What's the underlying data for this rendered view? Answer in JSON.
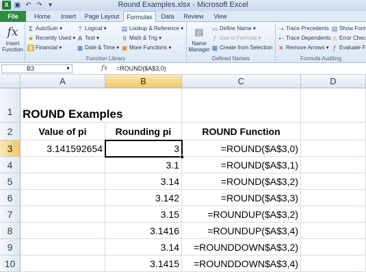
{
  "window": {
    "title": "Round Examples.xlsx - Microsoft Excel"
  },
  "qat": {
    "excel_icon": "X",
    "save_icon": "save-icon",
    "undo_icon": "undo-icon",
    "redo_icon": "redo-icon"
  },
  "tabs": [
    "File",
    "Home",
    "Insert",
    "Page Layout",
    "Formulas",
    "Data",
    "Review",
    "View"
  ],
  "active_tab": "Formulas",
  "ribbon": {
    "insert_function": {
      "icon": "fx",
      "label_line1": "Insert",
      "label_line2": "Function"
    },
    "function_library": {
      "label": "Function Library",
      "col1": [
        "AutoSum ▾",
        "Recently Used ▾",
        "Financial ▾"
      ],
      "col2": [
        "Logical ▾",
        "Text ▾",
        "Date & Time ▾"
      ],
      "col3": [
        "Lookup & Reference ▾",
        "Math & Trig ▾",
        "More Functions ▾"
      ]
    },
    "defined_names": {
      "label": "Defined Names",
      "name_manager_line1": "Name",
      "name_manager_line2": "Manager",
      "items": [
        "Define Name ▾",
        "Use in Formula ▾",
        "Create from Selection"
      ]
    },
    "formula_auditing": {
      "label": "Formula Auditing",
      "col1": [
        "Trace Precedents",
        "Trace Dependents",
        "Remove Arrows ▾"
      ],
      "col2": [
        "Show Form",
        "Error Check",
        "Evaluate Fo"
      ]
    }
  },
  "formula_bar": {
    "name_box": "B3",
    "fx": "fx",
    "formula": "=ROUND($A$3,0)"
  },
  "columns": [
    "A",
    "B",
    "C",
    "D"
  ],
  "rows": [
    "1",
    "2",
    "3",
    "4",
    "5",
    "6",
    "7",
    "8",
    "9",
    "10"
  ],
  "cells": {
    "A1": "ROUND Examples",
    "A2": "Value of pi",
    "B2": "Rounding pi",
    "C2": "ROUND Function",
    "A3": "3.141592654",
    "B3": "3",
    "C3": "=ROUND($A$3,0)",
    "B4": "3.1",
    "C4": "=ROUND($A$3,1)",
    "B5": "3.14",
    "C5": "=ROUND($A$3,2)",
    "B6": "3.142",
    "C6": "=ROUND($A$3,3)",
    "B7": "3.15",
    "C7": "=ROUNDUP($A$3,2)",
    "B8": "3.1416",
    "C8": "=ROUNDUP($A$3,4)",
    "B9": "3.14",
    "C9": "=ROUNDDOWN$A$3,2)",
    "B10": "3.1415",
    "C10": "=ROUNDDOWN$A$3,4)"
  },
  "active_cell": "B3",
  "colors": {
    "file_tab": "#2e8b40",
    "selected_header": "#f2c766",
    "ribbon": "#dce7f4"
  }
}
